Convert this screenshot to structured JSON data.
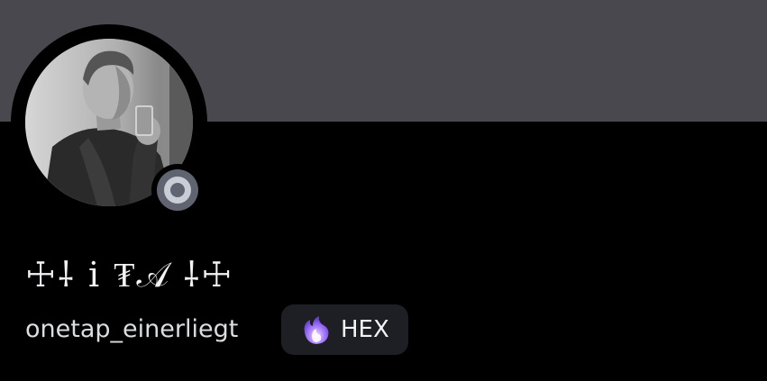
{
  "profile": {
    "display_name": "☩⸸ i ₮𝒜 ⸸☩",
    "username": "onetap_einerliegt",
    "status": "idle-offline",
    "tag": {
      "label": "HEX",
      "icon": "purple-flame-icon"
    }
  },
  "colors": {
    "banner": "#4a484f",
    "background": "#000000",
    "badge_background": "#1e1f24",
    "status_indicator": "#5f6470",
    "text_primary": "#f2f3f5"
  }
}
